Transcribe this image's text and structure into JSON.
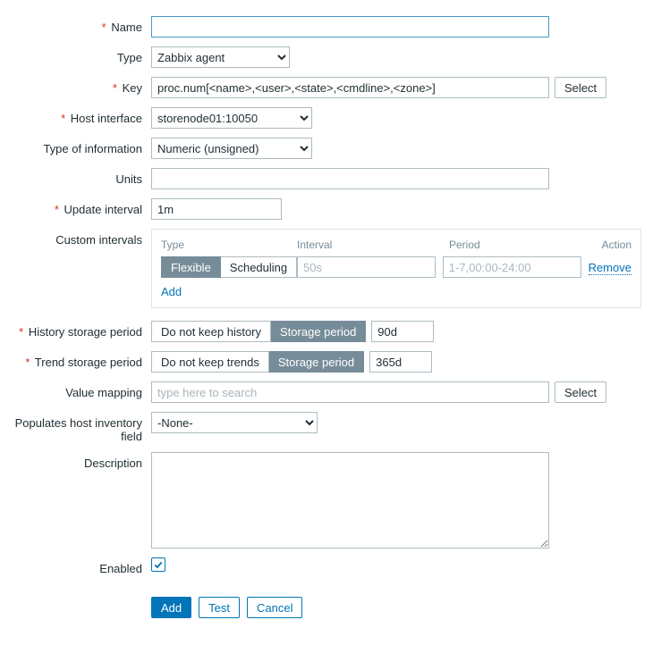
{
  "labels": {
    "name": "Name",
    "type": "Type",
    "key": "Key",
    "host_interface": "Host interface",
    "type_of_information": "Type of information",
    "units": "Units",
    "update_interval": "Update interval",
    "custom_intervals": "Custom intervals",
    "history_storage_period": "History storage period",
    "trend_storage_period": "Trend storage period",
    "value_mapping": "Value mapping",
    "populates_inventory": "Populates host inventory field",
    "description": "Description",
    "enabled": "Enabled"
  },
  "values": {
    "name": "",
    "type": "Zabbix agent",
    "key": "proc.num[<name>,<user>,<state>,<cmdline>,<zone>]",
    "host_interface": "storenode01:10050",
    "type_of_information": "Numeric (unsigned)",
    "units": "",
    "update_interval": "1m",
    "history_value": "90d",
    "trend_value": "365d",
    "value_mapping": "",
    "inventory": "-None-",
    "description": "",
    "enabled": true
  },
  "placeholders": {
    "interval": "50s",
    "period": "1-7,00:00-24:00",
    "value_mapping": "type here to search"
  },
  "custom_intervals": {
    "head": {
      "type": "Type",
      "interval": "Interval",
      "period": "Period",
      "action": "Action"
    },
    "seg": {
      "flexible": "Flexible",
      "scheduling": "Scheduling"
    },
    "remove": "Remove",
    "add": "Add"
  },
  "history_seg": {
    "no": "Do not keep history",
    "period": "Storage period"
  },
  "trend_seg": {
    "no": "Do not keep trends",
    "period": "Storage period"
  },
  "buttons": {
    "select": "Select",
    "add": "Add",
    "test": "Test",
    "cancel": "Cancel"
  }
}
